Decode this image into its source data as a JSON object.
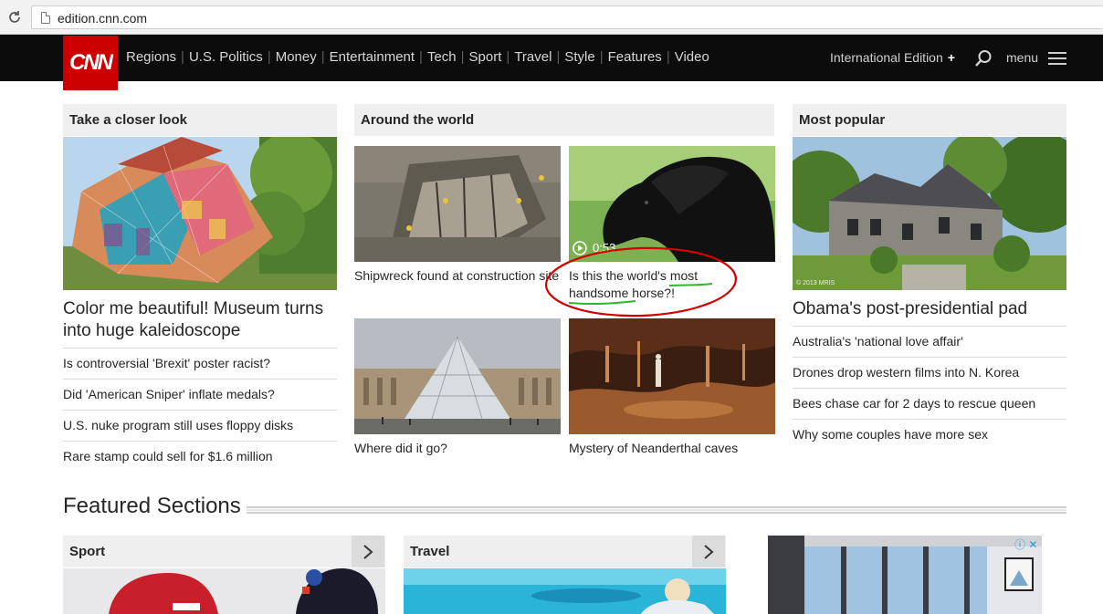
{
  "browser": {
    "url": "edition.cnn.com"
  },
  "nav": {
    "logo": "CNN",
    "links": [
      "Regions",
      "U.S. Politics",
      "Money",
      "Entertainment",
      "Tech",
      "Sport",
      "Travel",
      "Style",
      "Features",
      "Video"
    ],
    "edition": "International Edition",
    "edition_plus": "+",
    "menu": "menu"
  },
  "closer_look": {
    "title": "Take a closer look",
    "headline": "Color me beautiful! Museum turns into huge kaleidoscope",
    "links": [
      "Is controversial 'Brexit' poster racist?",
      "Did 'American Sniper' inflate medals?",
      "U.S. nuke program still uses floppy disks",
      "Rare stamp could sell for $1.6 million"
    ]
  },
  "around_world": {
    "title": "Around the world",
    "items": [
      {
        "caption": "Shipwreck found at construction site"
      },
      {
        "caption_a": "Is this the world's ",
        "caption_b": "most",
        "caption_c": "handsome",
        "caption_d": " horse?!",
        "video_time": "0:53"
      },
      {
        "caption": "Where did it go?"
      },
      {
        "caption": "Mystery of Neanderthal caves"
      }
    ]
  },
  "most_popular": {
    "title": "Most popular",
    "headline": "Obama's post-presidential pad",
    "photo_credit": "© 2013 MRIS",
    "links": [
      "Australia's 'national love affair'",
      "Drones drop western films into N. Korea",
      "Bees chase car for 2 days to rescue queen",
      "Why some couples have more sex"
    ]
  },
  "featured": {
    "title": "Featured Sections",
    "sections": [
      {
        "label": "Sport"
      },
      {
        "label": "Travel"
      }
    ],
    "ad_icons": "ⓘ ✕"
  },
  "colors": {
    "cnn_red": "#cc0000",
    "nav_bg": "#0c0c0c",
    "annotation_red": "#d40000",
    "annotation_green": "#2fb52f"
  }
}
